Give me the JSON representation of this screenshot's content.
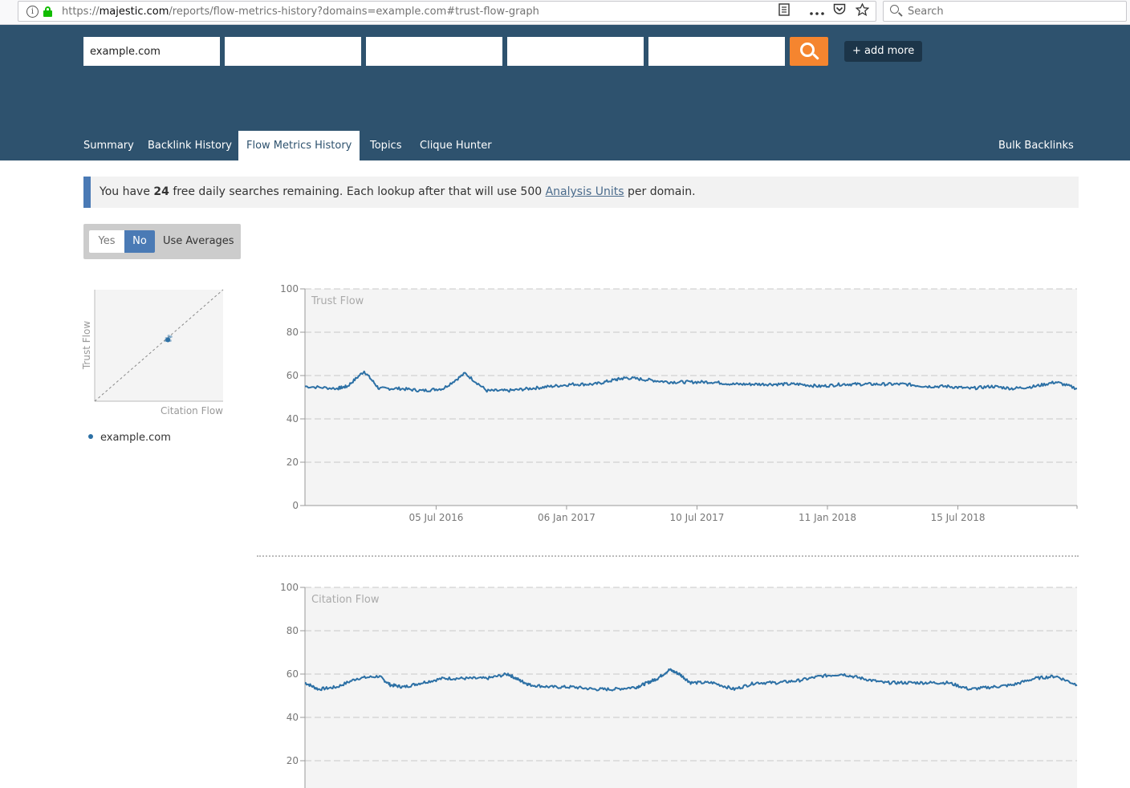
{
  "browser": {
    "url_scheme": "https://",
    "url_host": "majestic.com",
    "url_path": "/reports/flow-metrics-history?domains=example.com#trust-flow-graph",
    "search_placeholder": "Search",
    "icons": [
      "info-icon",
      "lock-icon",
      "reader-view-icon",
      "more-icon",
      "pocket-icon",
      "bookmark-star-icon",
      "search-icon"
    ]
  },
  "header": {
    "domains": [
      "example.com",
      "",
      "",
      "",
      ""
    ],
    "search_button_icon": "search-icon",
    "add_more_label": "+ add more",
    "colors": {
      "header_bg": "#2e526e",
      "search_button": "#f5852f",
      "add_more_bg": "#1c3549"
    }
  },
  "nav": {
    "tabs": [
      {
        "label": "Summary",
        "active": false
      },
      {
        "label": "Backlink History",
        "active": false
      },
      {
        "label": "Flow Metrics History",
        "active": true
      },
      {
        "label": "Topics",
        "active": false
      },
      {
        "label": "Clique Hunter",
        "active": false
      }
    ],
    "right_tab": "Bulk Backlinks"
  },
  "notice": {
    "prefix": "You have ",
    "count": "24",
    "middle": " free daily searches remaining. Each lookup after that will use 500 ",
    "link": "Analysis Units",
    "suffix": " per domain."
  },
  "averages_toggle": {
    "yes_label": "Yes",
    "no_label": "No",
    "selected": "No",
    "label": "Use Averages"
  },
  "legend": {
    "items": [
      {
        "name": "example.com",
        "color": "#2c70a5"
      }
    ]
  },
  "chart_data": [
    {
      "type": "scatter",
      "xlabel": "Citation Flow",
      "ylabel": "Trust Flow",
      "diagonal_reference_line": true,
      "points": [
        {
          "x": 57,
          "y": 55,
          "series": "example.com"
        }
      ],
      "grid": false
    },
    {
      "type": "line",
      "title": "Trust Flow",
      "ylim": [
        0,
        100
      ],
      "yticks": [
        0,
        20,
        40,
        60,
        80,
        100
      ],
      "xlim": [
        "2016-01-01",
        "2018-12-31"
      ],
      "xticks": [
        "05 Jul 2016",
        "06 Jan 2017",
        "10 Jul 2017",
        "11 Jan 2018",
        "15 Jul 2018"
      ],
      "grid": true,
      "series": [
        {
          "name": "example.com",
          "color": "#2c70a5",
          "x": [
            "2016-01-01",
            "2016-02-15",
            "2016-03-01",
            "2016-03-25",
            "2016-04-15",
            "2016-05-15",
            "2016-06-15",
            "2016-07-15",
            "2016-08-15",
            "2016-09-15",
            "2016-10-15",
            "2016-11-15",
            "2016-12-15",
            "2017-01-15",
            "2017-02-15",
            "2017-03-15",
            "2017-04-01",
            "2017-05-01",
            "2017-06-01",
            "2017-07-01",
            "2017-08-01",
            "2017-09-01",
            "2017-10-01",
            "2017-11-01",
            "2017-12-01",
            "2018-01-01",
            "2018-02-01",
            "2018-03-01",
            "2018-04-01",
            "2018-05-01",
            "2018-06-01",
            "2018-07-01",
            "2018-08-01",
            "2018-09-01",
            "2018-10-01",
            "2018-11-01",
            "2018-12-01",
            "2018-12-31"
          ],
          "values": [
            55,
            54,
            55,
            62,
            54,
            54,
            53,
            54,
            61,
            53,
            53,
            54,
            55,
            56,
            56,
            58,
            59,
            58,
            57,
            57,
            57,
            56,
            56,
            56,
            56,
            55,
            56,
            56,
            56,
            56,
            55,
            55,
            54,
            55,
            54,
            55,
            57,
            54
          ]
        }
      ]
    },
    {
      "type": "line",
      "title": "Citation Flow",
      "ylim": [
        0,
        100
      ],
      "yticks": [
        20,
        40,
        60,
        80,
        100
      ],
      "xlim": [
        "2016-01-01",
        "2018-12-31"
      ],
      "grid": true,
      "series": [
        {
          "name": "example.com",
          "color": "#2c70a5",
          "x": [
            "2016-01-01",
            "2016-01-20",
            "2016-02-15",
            "2016-03-15",
            "2016-04-15",
            "2016-05-01",
            "2016-05-20",
            "2016-06-15",
            "2016-07-15",
            "2016-08-15",
            "2016-09-15",
            "2016-10-15",
            "2016-11-01",
            "2016-11-15",
            "2016-12-15",
            "2017-01-15",
            "2017-02-15",
            "2017-03-15",
            "2017-04-15",
            "2017-05-01",
            "2017-05-15",
            "2017-06-01",
            "2017-06-15",
            "2017-07-01",
            "2017-08-01",
            "2017-09-01",
            "2017-10-01",
            "2017-11-01",
            "2017-12-01",
            "2018-01-01",
            "2018-02-01",
            "2018-03-01",
            "2018-04-01",
            "2018-05-01",
            "2018-06-01",
            "2018-07-01",
            "2018-08-01",
            "2018-09-01",
            "2018-10-01",
            "2018-11-01",
            "2018-12-01",
            "2018-12-31"
          ],
          "values": [
            56,
            53,
            54,
            58,
            59,
            55,
            54,
            56,
            58,
            58,
            58,
            60,
            57,
            55,
            54,
            54,
            53,
            53,
            54,
            56,
            58,
            62,
            60,
            56,
            56,
            53,
            56,
            56,
            57,
            59,
            60,
            58,
            56,
            56,
            56,
            56,
            53,
            54,
            55,
            58,
            59,
            55
          ]
        }
      ]
    }
  ]
}
